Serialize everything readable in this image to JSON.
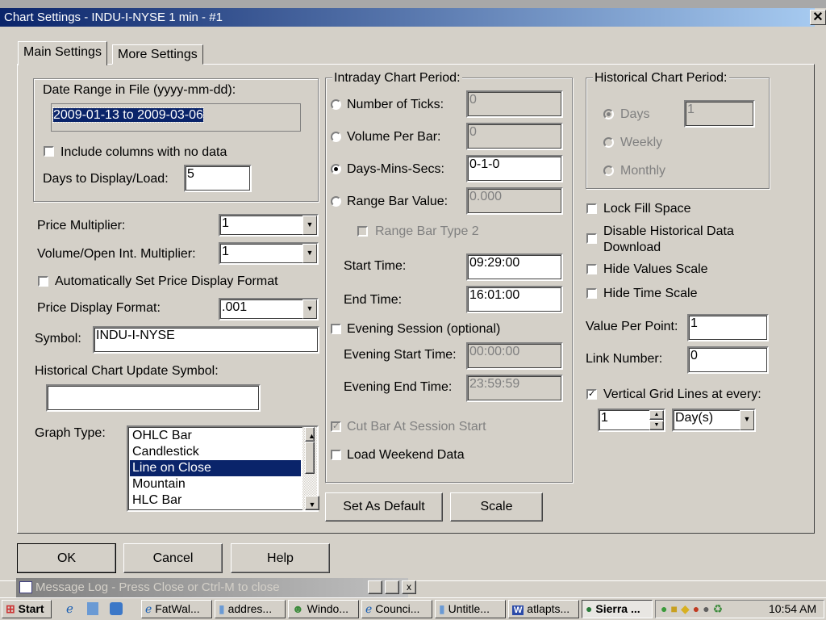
{
  "window": {
    "title": "Chart Settings - INDU-I-NYSE  1 min  - #1",
    "close": "✕"
  },
  "tabs": [
    "Main Settings",
    "More Settings"
  ],
  "date_range": {
    "label": "Date Range in File (yyyy-mm-dd):",
    "value": "2009-01-13 to 2009-03-06",
    "include_no_data": "Include columns with no data",
    "include_checked": false,
    "days_label": "Days to Display/Load:",
    "days_value": "5"
  },
  "price_multiplier": {
    "label": "Price Multiplier:",
    "value": "1"
  },
  "volume_multiplier": {
    "label": "Volume/Open Int. Multiplier:",
    "value": "1"
  },
  "auto_format": {
    "label": "Automatically Set Price Display Format",
    "checked": false
  },
  "price_format": {
    "label": "Price Display Format:",
    "value": ".001"
  },
  "symbol": {
    "label": "Symbol:",
    "value": "INDU-I-NYSE"
  },
  "hist_update": {
    "label": "Historical Chart Update Symbol:",
    "value": ""
  },
  "graph_type": {
    "label": "Graph Type:",
    "options": [
      "OHLC Bar",
      "Candlestick",
      "Line on Close",
      "Mountain",
      "HLC Bar"
    ],
    "selected": "Line on Close"
  },
  "intraday": {
    "label": "Intraday Chart Period:",
    "ticks": {
      "label": "Number of Ticks:",
      "value": "0"
    },
    "volume": {
      "label": "Volume Per Bar:",
      "value": "0"
    },
    "dms": {
      "label": "Days-Mins-Secs:",
      "value": "0-1-0",
      "selected": true
    },
    "range": {
      "label": "Range Bar Value:",
      "value": "0.000"
    },
    "range_type2": "Range Bar Type 2",
    "start": {
      "label": "Start Time:",
      "value": "09:29:00"
    },
    "end": {
      "label": "End Time:",
      "value": "16:01:00"
    },
    "evening": "Evening Session (optional)",
    "ev_start": {
      "label": "Evening Start Time:",
      "value": "00:00:00"
    },
    "ev_end": {
      "label": "Evening End Time:",
      "value": "23:59:59"
    },
    "cut_bar": "Cut Bar At Session Start",
    "weekend": "Load Weekend Data"
  },
  "historical": {
    "label": "Historical Chart Period:",
    "days": "Days",
    "days_value": "1",
    "weekly": "Weekly",
    "monthly": "Monthly"
  },
  "options": {
    "lock_fill": "Lock Fill Space",
    "disable_hist_1": "Disable Historical Data",
    "disable_hist_2": "Download",
    "hide_values": "Hide Values Scale",
    "hide_time": "Hide Time Scale"
  },
  "value_per_point": {
    "label": "Value Per Point:",
    "value": "1"
  },
  "link_number": {
    "label": "Link Number:",
    "value": "0"
  },
  "vgrid": {
    "label": "Vertical Grid Lines at every:",
    "checked": true,
    "count": "1",
    "unit": "Day(s)"
  },
  "buttons": {
    "set_default": "Set As Default",
    "scale": "Scale",
    "ok": "OK",
    "cancel": "Cancel",
    "help": "Help"
  },
  "message_log": {
    "title": "Message Log - Press Close or Ctrl-M to close"
  },
  "taskbar": {
    "start": "Start",
    "items": [
      "FatWal...",
      "addres...",
      "Windo...",
      "Counci...",
      "Untitle...",
      "atlapts...",
      "Sierra ..."
    ],
    "clock": "10:54 AM"
  }
}
